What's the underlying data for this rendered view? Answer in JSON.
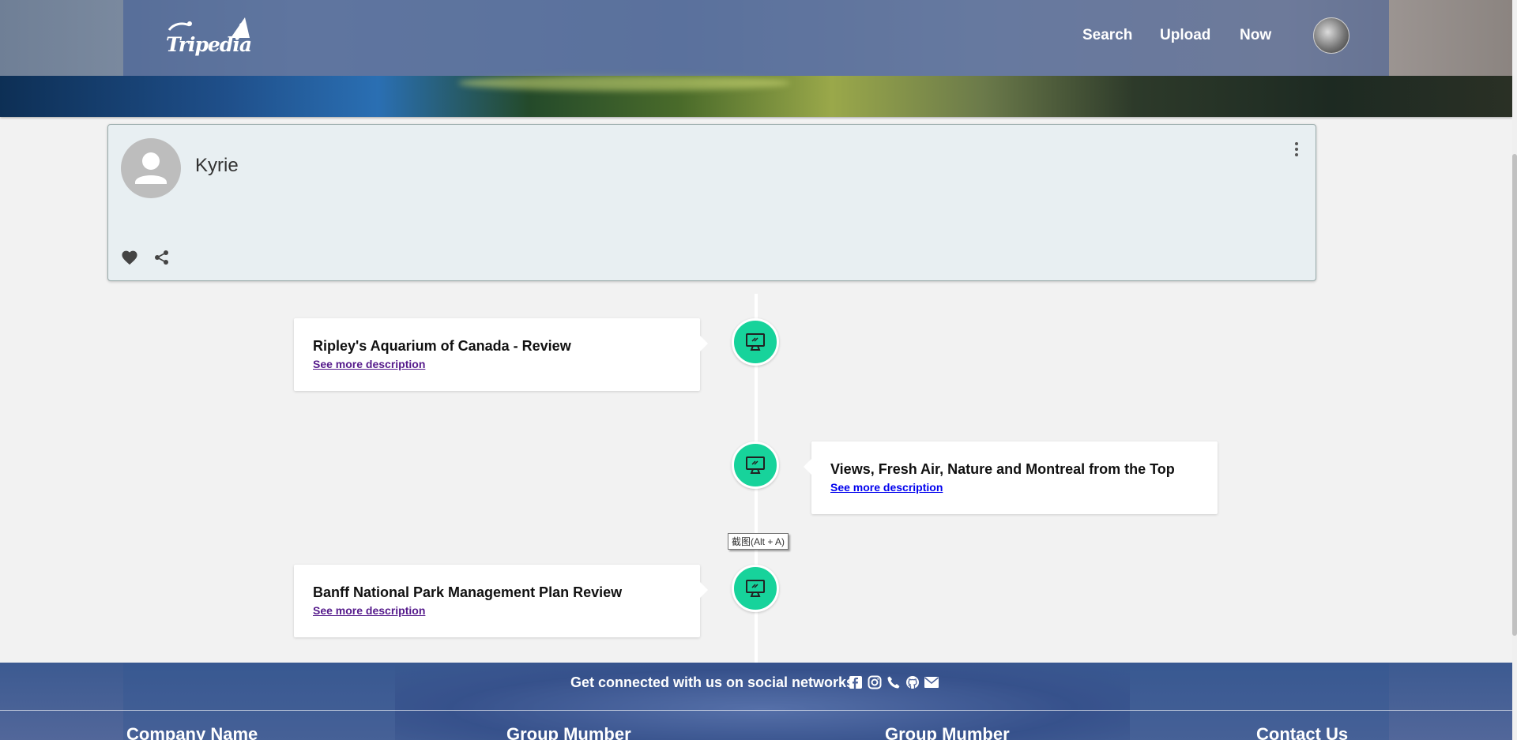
{
  "nav": {
    "logo_text": "Tripedia",
    "links": [
      "Search",
      "Upload",
      "Now"
    ]
  },
  "profile": {
    "name": "Kyrie"
  },
  "timeline": {
    "items": [
      {
        "title": "Ripley's Aquarium of Canada - Review",
        "link": "See more description",
        "side": "left",
        "link_color": "#551a8b"
      },
      {
        "title": "Views, Fresh Air, Nature and Montreal from the Top",
        "link": "See more description",
        "side": "right",
        "link_color": "#0000ee"
      },
      {
        "title": "Banff National Park Management Plan Review",
        "link": "See more description",
        "side": "left",
        "link_color": "#551a8b"
      }
    ],
    "node_icon": "monitor-icon",
    "node_color": "#17d39b"
  },
  "tooltip": {
    "text": "截图(Alt + A)"
  },
  "footer": {
    "social_text": "Get connected with us on social networks:",
    "social_icons": [
      "facebook-icon",
      "instagram-icon",
      "phone-icon",
      "github-icon",
      "mail-icon"
    ],
    "columns": [
      "Company Name",
      "Group Mumber",
      "Group Mumber",
      "Contact Us"
    ]
  }
}
